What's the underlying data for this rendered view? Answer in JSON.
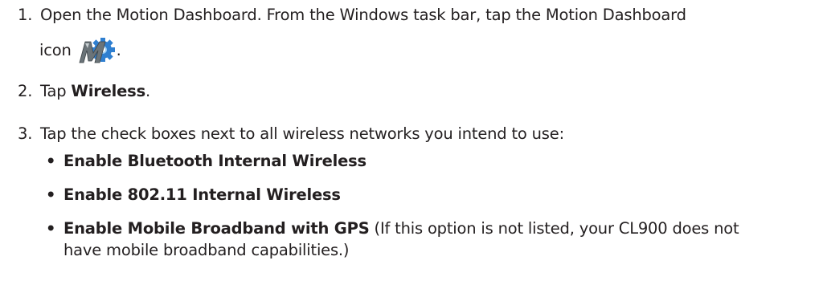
{
  "steps": [
    {
      "number": "1.",
      "text_line1": "Open the Motion Dashboard. From the Windows task bar, tap the Motion Dashboard",
      "text_line2_before": "icon",
      "text_line2_after": "."
    },
    {
      "number": "2.",
      "prefix": "Tap ",
      "bold": "Wireless",
      "suffix": "."
    },
    {
      "number": "3.",
      "text": "Tap the check boxes next to all wireless networks you intend to use:"
    }
  ],
  "bullets": [
    {
      "marker": "•",
      "bold": "Enable Bluetooth Internal Wireless",
      "rest": ""
    },
    {
      "marker": "•",
      "bold": "Enable 802.11 Internal Wireless",
      "rest": ""
    },
    {
      "marker": "•",
      "bold": "Enable Mobile Broadband with GPS",
      "rest": " (If this option is not listed, your CL900 does not",
      "rest_line2": "have mobile broadband capabilities.)"
    }
  ],
  "icons": {
    "dashboard_icon": "motion-dashboard-icon",
    "colors": {
      "gear": "#2f7fd0",
      "letter": "#6b7479"
    }
  }
}
